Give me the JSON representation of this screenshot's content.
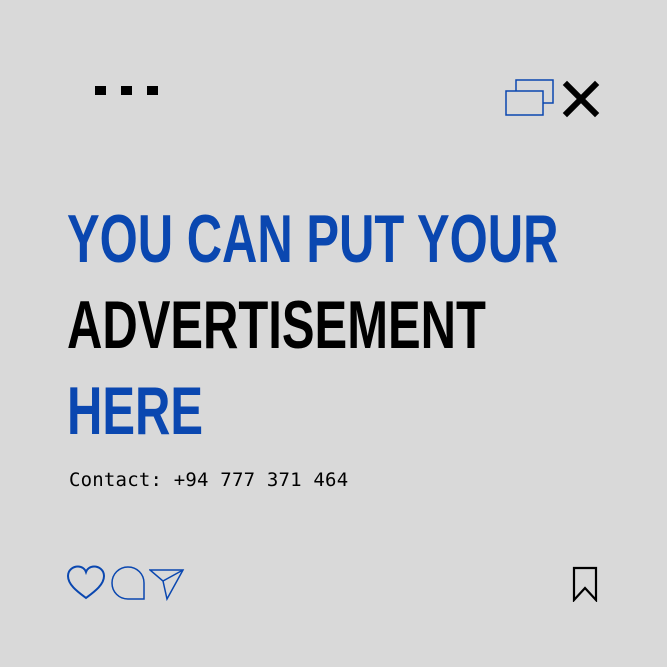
{
  "headline": {
    "line1": "YOU CAN PUT YOUR",
    "line2": "ADVERTISEMENT",
    "line3": "HERE"
  },
  "contact": "Contact: +94 777 371 464",
  "colors": {
    "background": "#d9d9d9",
    "accent_blue": "#0a47b0",
    "text_black": "#000000"
  },
  "icons": {
    "menu": "more-dots-icon",
    "windows": "overlapping-windows-icon",
    "close": "close-icon",
    "like": "heart-icon",
    "comment": "comment-icon",
    "share": "send-icon",
    "save": "bookmark-icon"
  }
}
